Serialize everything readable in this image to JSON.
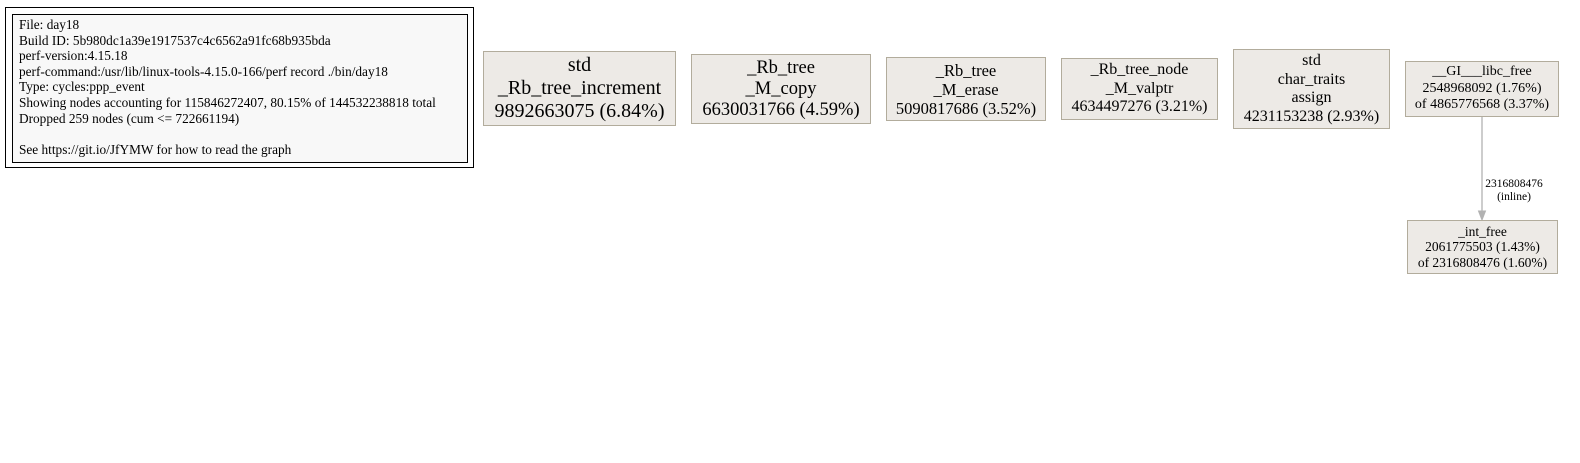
{
  "legend": {
    "lines": [
      "File: day18",
      "Build ID: 5b980dc1a39e1917537c4c6562a91fc68b935bda",
      "perf-version:4.15.18",
      "perf-command:/usr/lib/linux-tools-4.15.0-166/perf record ./bin/day18",
      "Type: cycles:ppp_event",
      "Showing nodes accounting for 115846272407, 80.15% of 144532238818 total",
      "Dropped 259 nodes (cum <= 722661194)",
      "",
      "See https://git.io/JfYMW for how to read the graph"
    ]
  },
  "nodes": [
    {
      "id": "rb-tree-increment",
      "lines": [
        "std",
        "_Rb_tree_increment",
        "9892663075 (6.84%)"
      ]
    },
    {
      "id": "rb-tree-m-copy",
      "lines": [
        "_Rb_tree",
        "_M_copy",
        "6630031766 (4.59%)"
      ]
    },
    {
      "id": "rb-tree-m-erase",
      "lines": [
        "_Rb_tree",
        "_M_erase",
        "5090817686 (3.52%)"
      ]
    },
    {
      "id": "rb-tree-node-m-valptr",
      "lines": [
        "_Rb_tree_node",
        "_M_valptr",
        "4634497276 (3.21%)"
      ]
    },
    {
      "id": "char-traits-assign",
      "lines": [
        "std",
        "char_traits",
        "assign",
        "4231153238 (2.93%)"
      ]
    },
    {
      "id": "gi-libc-free",
      "lines": [
        "__GI___libc_free",
        "2548968092 (1.76%)",
        "of 4865776568 (3.37%)"
      ]
    },
    {
      "id": "int-free",
      "lines": [
        "_int_free",
        "2061775503 (1.43%)",
        "of 2316808476 (1.60%)"
      ]
    }
  ],
  "edges": [
    {
      "id": "libc-free-to-int-free",
      "label_lines": [
        "2316808476",
        "(inline)"
      ],
      "color": "#b2b2b2"
    }
  ],
  "colors": {
    "node_fill": "#edeae6",
    "node_border": "#b2ac9c",
    "edge": "#b2b2b2"
  }
}
